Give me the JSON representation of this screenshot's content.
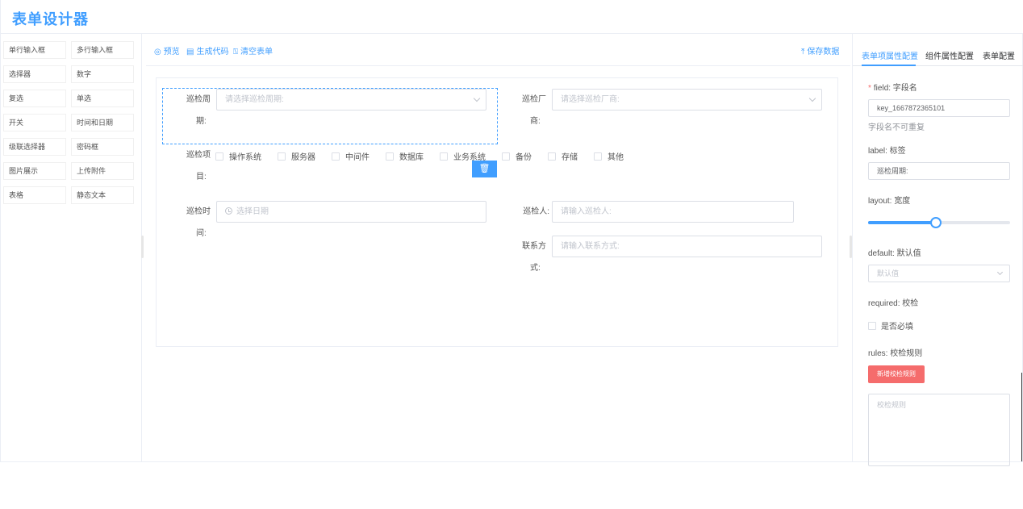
{
  "app": {
    "title": "表单设计器"
  },
  "palette": {
    "items": [
      "单行输入框",
      "多行输入框",
      "选择器",
      "数字",
      "复选",
      "单选",
      "开关",
      "时间和日期",
      "级联选择器",
      "密码框",
      "图片展示",
      "上传附件",
      "表格",
      "静态文本"
    ]
  },
  "toolbar": {
    "preview": "预览",
    "generate_code": "生成代码",
    "clear_form": "清空表单",
    "save_data": "保存数据"
  },
  "form": {
    "cycle": {
      "label_1": "巡检周",
      "label_2": "期:",
      "placeholder": "请选择巡检周期:"
    },
    "vendor": {
      "label_1": "巡检厂",
      "label_2": "商:",
      "placeholder": "请选择巡检厂商:"
    },
    "items": {
      "label_1": "巡检项",
      "label_2": "目:",
      "options": [
        "操作系统",
        "服务器",
        "中间件",
        "数据库",
        "业务系统",
        "备份",
        "存储",
        "其他"
      ]
    },
    "time": {
      "label_1": "巡检时",
      "label_2": "间:",
      "placeholder": "选择日期"
    },
    "inspector": {
      "label": "巡检人:",
      "placeholder": "请输入巡检人:"
    },
    "contact": {
      "label_1": "联系方",
      "label_2": "式:",
      "placeholder": "请输入联系方式:"
    }
  },
  "panel": {
    "tabs": [
      "表单项属性配置",
      "组件属性配置",
      "表单配置"
    ],
    "active_tab": 0,
    "field_label": "field: 字段名",
    "field_value": "key_1667872365101",
    "field_hint": "字段名不可重复",
    "label_label": "label: 标签",
    "label_value": "巡检周期:",
    "layout_label": "layout: 宽度",
    "layout_fraction": 0.48,
    "default_label": "default: 默认值",
    "default_placeholder": "默认值",
    "required_label": "required: 校检",
    "required_checkbox": "是否必填",
    "rules_label": "rules: 校检规则",
    "add_rule_button": "新增校检规则",
    "rules_placeholder": "校检规则"
  },
  "colors": {
    "primary": "#409eff",
    "danger": "#f56c6c",
    "border": "#dcdfe6"
  }
}
